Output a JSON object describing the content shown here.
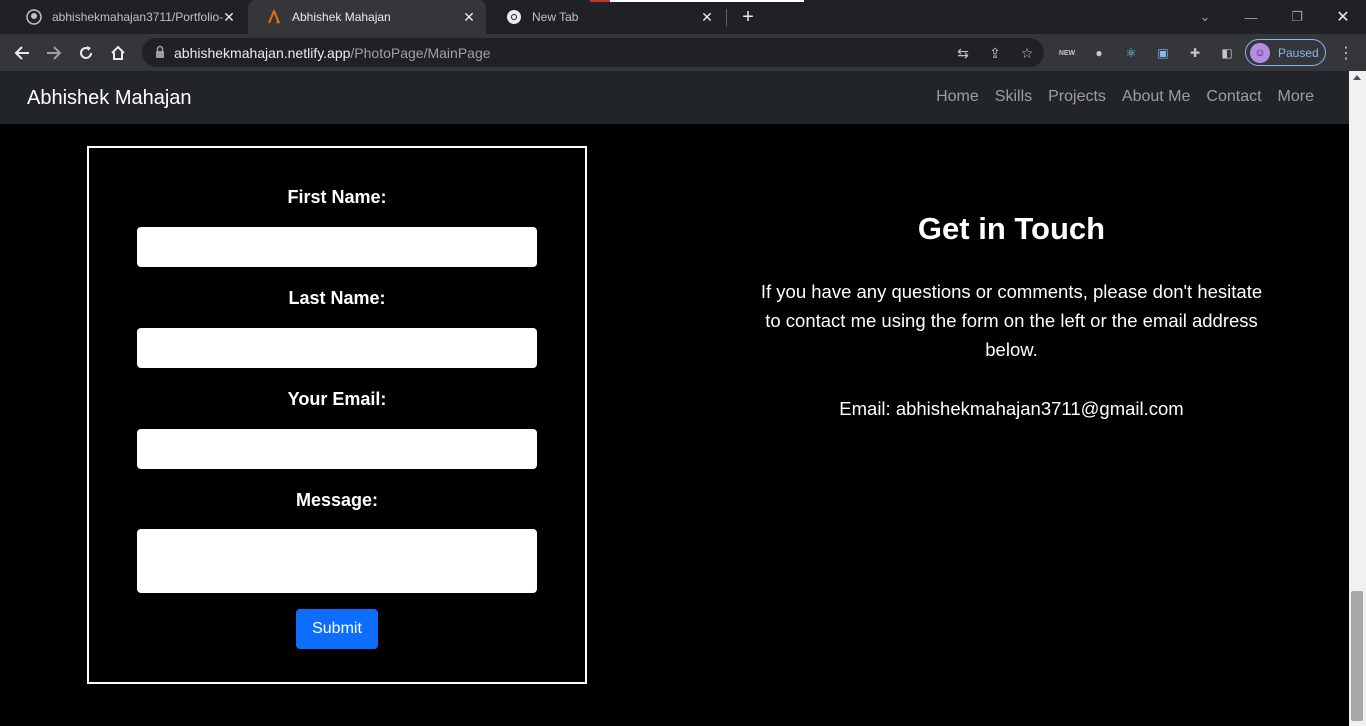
{
  "browser": {
    "tabs": [
      {
        "title": "abhishekmahajan3711/Portfolio-",
        "icon": "github-icon",
        "active": false
      },
      {
        "title": "Abhishek Mahajan",
        "icon": "site-logo-icon",
        "active": true
      },
      {
        "title": "New Tab",
        "icon": "chrome-icon",
        "active": false
      }
    ],
    "url_host": "abhishekmahajan.netlify.app",
    "url_path": "/PhotoPage/MainPage",
    "profile_label": "Paused",
    "ext_new_badge": "NEW"
  },
  "navbar": {
    "brand": "Abhishek Mahajan",
    "links": [
      "Home",
      "Skills",
      "Projects",
      "About Me",
      "Contact",
      "More"
    ]
  },
  "form": {
    "first_name_label": "First Name:",
    "last_name_label": "Last Name:",
    "email_label": "Your Email:",
    "message_label": "Message:",
    "submit_label": "Submit"
  },
  "contact": {
    "heading": "Get in Touch",
    "message": "If you have any questions or comments, please don't hesitate to contact me using the form on the left or the email address below.",
    "email_line": "Email: abhishekmahajan3711@gmail.com"
  },
  "colors": {
    "navbar_bg": "#212529",
    "submit_bg": "#0d6efd",
    "page_bg": "#000000"
  }
}
